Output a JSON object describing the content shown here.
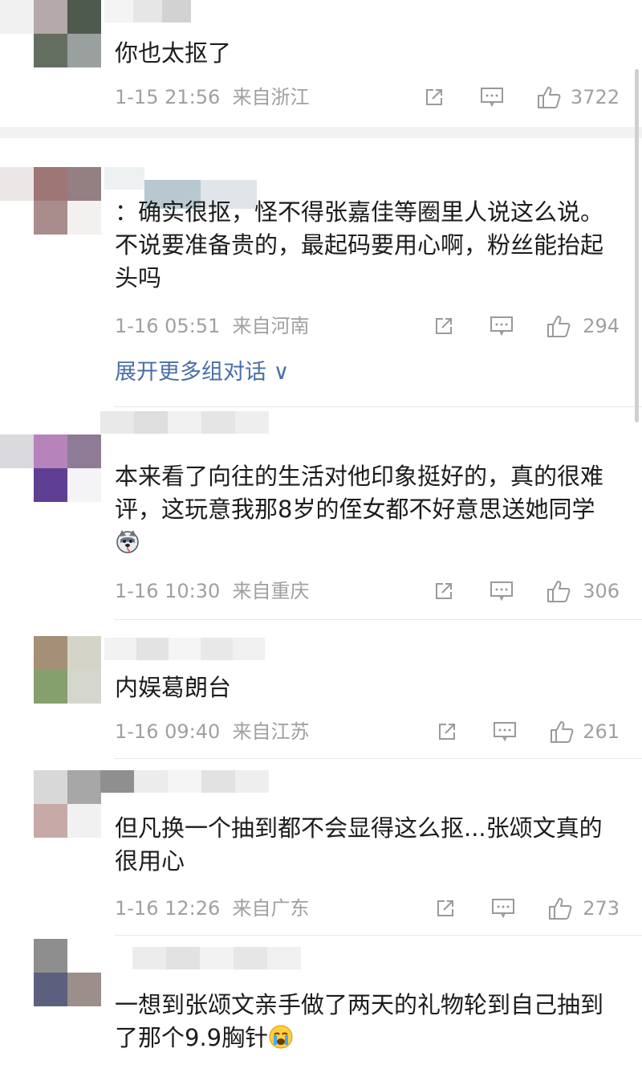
{
  "comments": [
    {
      "text": "你也太抠了",
      "time": "1-15 21:56",
      "location": "来自浙江",
      "likes": "3722"
    },
    {
      "text": "：确实很抠，怪不得张嘉佳等圈里人说这么说。不说要准备贵的，最起码要用心啊，粉丝能抬起头吗",
      "time": "1-16 05:51",
      "location": "来自河南",
      "likes": "294",
      "expand": "展开更多组对话 ∨"
    },
    {
      "text": "本来看了向往的生活对他印象挺好的，真的很难评，这玩意我那8岁的侄女都不好意思送她同学",
      "time": "1-16 10:30",
      "location": "来自重庆",
      "likes": "306"
    },
    {
      "text": "内娱葛朗台",
      "time": "1-16 09:40",
      "location": "来自江苏",
      "likes": "261"
    },
    {
      "text": "但凡换一个抽到都不会显得这么抠...张颂文真的很用心",
      "time": "1-16 12:26",
      "location": "来自广东",
      "likes": "273"
    },
    {
      "text": "一想到张颂文亲手做了两天的礼物轮到自己抽到了那个9.9胸针",
      "time": "",
      "location": "",
      "likes": ""
    }
  ],
  "icons": {
    "share": "share-icon",
    "reply": "comment-icon",
    "like": "thumbs-up-icon",
    "emoji1": "husky-emoji-icon",
    "emoji2": "crying-emoji-icon"
  },
  "colors": {
    "link": "#4a6fa5",
    "meta": "#a0a0a0",
    "text": "#1c1c1c"
  }
}
